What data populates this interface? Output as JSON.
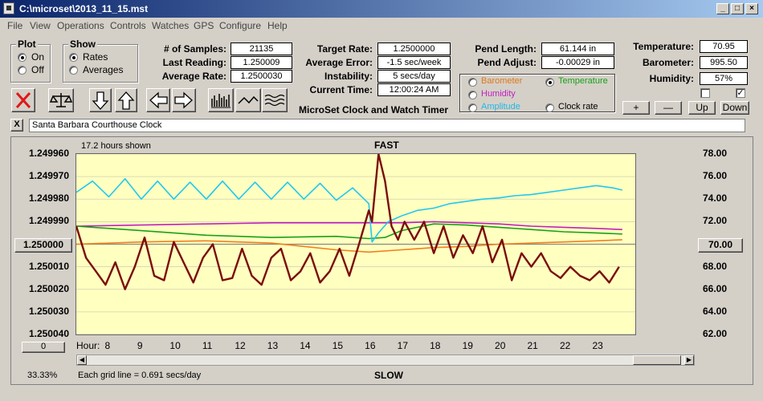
{
  "window": {
    "title": "C:\\microset\\2013_11_15.mst"
  },
  "menu": [
    "File",
    "View",
    "Operations",
    "Controls",
    "Watches",
    "GPS",
    "Configure",
    "Help"
  ],
  "plot_group": {
    "label": "Plot",
    "on": "On",
    "off": "Off",
    "selected": "On"
  },
  "show_group": {
    "label": "Show",
    "rates": "Rates",
    "averages": "Averages",
    "selected": "Rates"
  },
  "stats": {
    "samples_label": "# of Samples:",
    "samples": "21135",
    "last_label": "Last Reading:",
    "last": "1.250009",
    "avg_label": "Average Rate:",
    "avg": "1.2500030",
    "target_label": "Target Rate:",
    "target": "1.2500000",
    "avgerr_label": "Average Error:",
    "avgerr": "-1.5 sec/week",
    "instab_label": "Instability:",
    "instab": "5 secs/day",
    "time_label": "Current Time:",
    "time": "12:00:24 AM",
    "pendlen_label": "Pend Length:",
    "pendlen": "61.144 in",
    "pendadj_label": "Pend Adjust:",
    "pendadj": "-0.00029 in",
    "temp_label": "Temperature:",
    "temp": "70.95",
    "baro_label": "Barometer:",
    "baro": "995.50",
    "hum_label": "Humidity:",
    "hum": "57%"
  },
  "app_title": "MicroSet Clock and Watch Timer",
  "channel_select": {
    "barometer": "Barometer",
    "temperature": "Temperature",
    "humidity": "Humidity",
    "amplitude": "Amplitude",
    "clock_rate": "Clock rate",
    "selected": "Temperature"
  },
  "scale_buttons": {
    "plus": "+",
    "minus": "—",
    "up": "Up",
    "down": "Down"
  },
  "description": "Santa Barbara Courthouse Clock",
  "close_desc": "X",
  "chart_info": {
    "hours_shown": "17.2 hours shown",
    "fast": "FAST",
    "slow": "SLOW",
    "grid_note": "Each grid line = 0.691 secs/day",
    "zoom": "33.33%",
    "center_value": "1.250000",
    "center_right": "70.00",
    "offset_button": "0",
    "hour_label": "Hour:"
  },
  "colors": {
    "rate": "#7a0c0c",
    "temperature": "#1aa01a",
    "humidity": "#c020c0",
    "amplitude": "#20c8f0",
    "barometer": "#f08020",
    "plot_bg": "#ffffc0"
  },
  "chart_data": {
    "type": "line",
    "x_label": "Hour:",
    "x_ticks": [
      8,
      9,
      10,
      11,
      12,
      13,
      14,
      15,
      16,
      17,
      18,
      19,
      20,
      21,
      22,
      23
    ],
    "xlim": [
      7.0,
      24.2
    ],
    "y_left_ticks": [
      "1.249960",
      "1.249970",
      "1.249980",
      "1.249990",
      "1.250000",
      "1.250010",
      "1.250020",
      "1.250030",
      "1.250040"
    ],
    "ylim_left": [
      1.24996,
      1.25004
    ],
    "y_right_ticks": [
      "78.00",
      "76.00",
      "74.00",
      "72.00",
      "70.00",
      "68.00",
      "66.00",
      "64.00",
      "62.00"
    ],
    "ylim_right": [
      62,
      78
    ],
    "series": [
      {
        "name": "Rate",
        "color": "#7a0c0c",
        "x": [
          7.0,
          7.3,
          7.6,
          7.9,
          8.2,
          8.5,
          8.8,
          9.1,
          9.4,
          9.7,
          10.0,
          10.3,
          10.6,
          10.9,
          11.2,
          11.5,
          11.8,
          12.1,
          12.4,
          12.7,
          13.0,
          13.3,
          13.6,
          13.9,
          14.2,
          14.5,
          14.8,
          15.1,
          15.4,
          15.7,
          16.0,
          16.1,
          16.3,
          16.5,
          16.7,
          16.9,
          17.1,
          17.4,
          17.7,
          18.0,
          18.3,
          18.6,
          18.9,
          19.2,
          19.5,
          19.8,
          20.1,
          20.4,
          20.7,
          21.0,
          21.3,
          21.6,
          21.9,
          22.2,
          22.5,
          22.8,
          23.1,
          23.4,
          23.7
        ],
        "y": [
          1.249992,
          1.250006,
          1.250012,
          1.250018,
          1.250008,
          1.25002,
          1.25001,
          1.249997,
          1.250014,
          1.250016,
          1.249999,
          1.250008,
          1.250017,
          1.250006,
          1.25,
          1.250016,
          1.250015,
          1.250002,
          1.250014,
          1.250018,
          1.250006,
          1.250002,
          1.250016,
          1.250012,
          1.250004,
          1.250017,
          1.250012,
          1.250002,
          1.250014,
          1.25,
          1.249985,
          1.24999,
          1.24996,
          1.249972,
          1.249992,
          1.249998,
          1.24999,
          1.249998,
          1.24999,
          1.250004,
          1.249992,
          1.250006,
          1.249996,
          1.250004,
          1.249992,
          1.250008,
          1.249998,
          1.250016,
          1.250004,
          1.25001,
          1.250004,
          1.250012,
          1.250015,
          1.25001,
          1.250014,
          1.250016,
          1.250012,
          1.250017,
          1.25001
        ]
      },
      {
        "name": "Temperature",
        "color": "#1aa01a",
        "x": [
          7.0,
          9.0,
          11.0,
          13.0,
          15.0,
          16.0,
          16.5,
          17.0,
          17.5,
          18.0,
          19.0,
          20.0,
          21.0,
          22.0,
          23.0,
          23.8
        ],
        "y": [
          71.6,
          71.2,
          70.8,
          70.6,
          70.7,
          70.5,
          70.6,
          71.2,
          71.5,
          71.8,
          71.7,
          71.5,
          71.3,
          71.1,
          71.0,
          70.9
        ]
      },
      {
        "name": "Humidity",
        "color": "#c020c0",
        "x": [
          7.0,
          9.0,
          11.0,
          13.0,
          15.0,
          16.0,
          17.0,
          18.0,
          19.0,
          20.0,
          21.0,
          22.0,
          23.0,
          23.8
        ],
        "y": [
          71.6,
          71.7,
          71.8,
          71.9,
          71.9,
          71.9,
          71.9,
          72.0,
          71.9,
          71.8,
          71.6,
          71.5,
          71.4,
          71.3
        ]
      },
      {
        "name": "Barometer",
        "color": "#f08020",
        "x": [
          7.0,
          9.0,
          11.0,
          13.0,
          15.0,
          16.0,
          17.0,
          18.0,
          19.0,
          20.0,
          21.0,
          22.0,
          23.0,
          23.8
        ],
        "y": [
          70.0,
          70.2,
          70.3,
          70.1,
          69.5,
          69.3,
          69.5,
          69.7,
          69.8,
          70.0,
          70.1,
          70.2,
          70.3,
          70.4
        ]
      },
      {
        "name": "Amplitude",
        "color": "#20c8f0",
        "x": [
          7.0,
          7.5,
          8.0,
          8.5,
          9.0,
          9.5,
          10.0,
          10.5,
          11.0,
          11.5,
          12.0,
          12.5,
          13.0,
          13.5,
          14.0,
          14.5,
          15.0,
          15.5,
          16.0,
          16.1,
          16.3,
          16.6,
          17.0,
          17.5,
          18.0,
          18.5,
          19.0,
          19.5,
          20.0,
          20.5,
          21.0,
          21.5,
          22.0,
          22.5,
          23.0,
          23.5,
          23.8
        ],
        "y": [
          74.6,
          75.6,
          74.2,
          75.8,
          74.0,
          75.6,
          74.0,
          75.5,
          74.0,
          75.6,
          74.0,
          75.5,
          74.0,
          75.5,
          74.0,
          75.4,
          73.9,
          75.0,
          73.6,
          70.2,
          71.0,
          72.0,
          72.5,
          73.0,
          73.2,
          73.6,
          73.8,
          74.0,
          74.1,
          74.3,
          74.4,
          74.6,
          74.8,
          75.0,
          75.2,
          75.0,
          74.8
        ]
      }
    ]
  }
}
